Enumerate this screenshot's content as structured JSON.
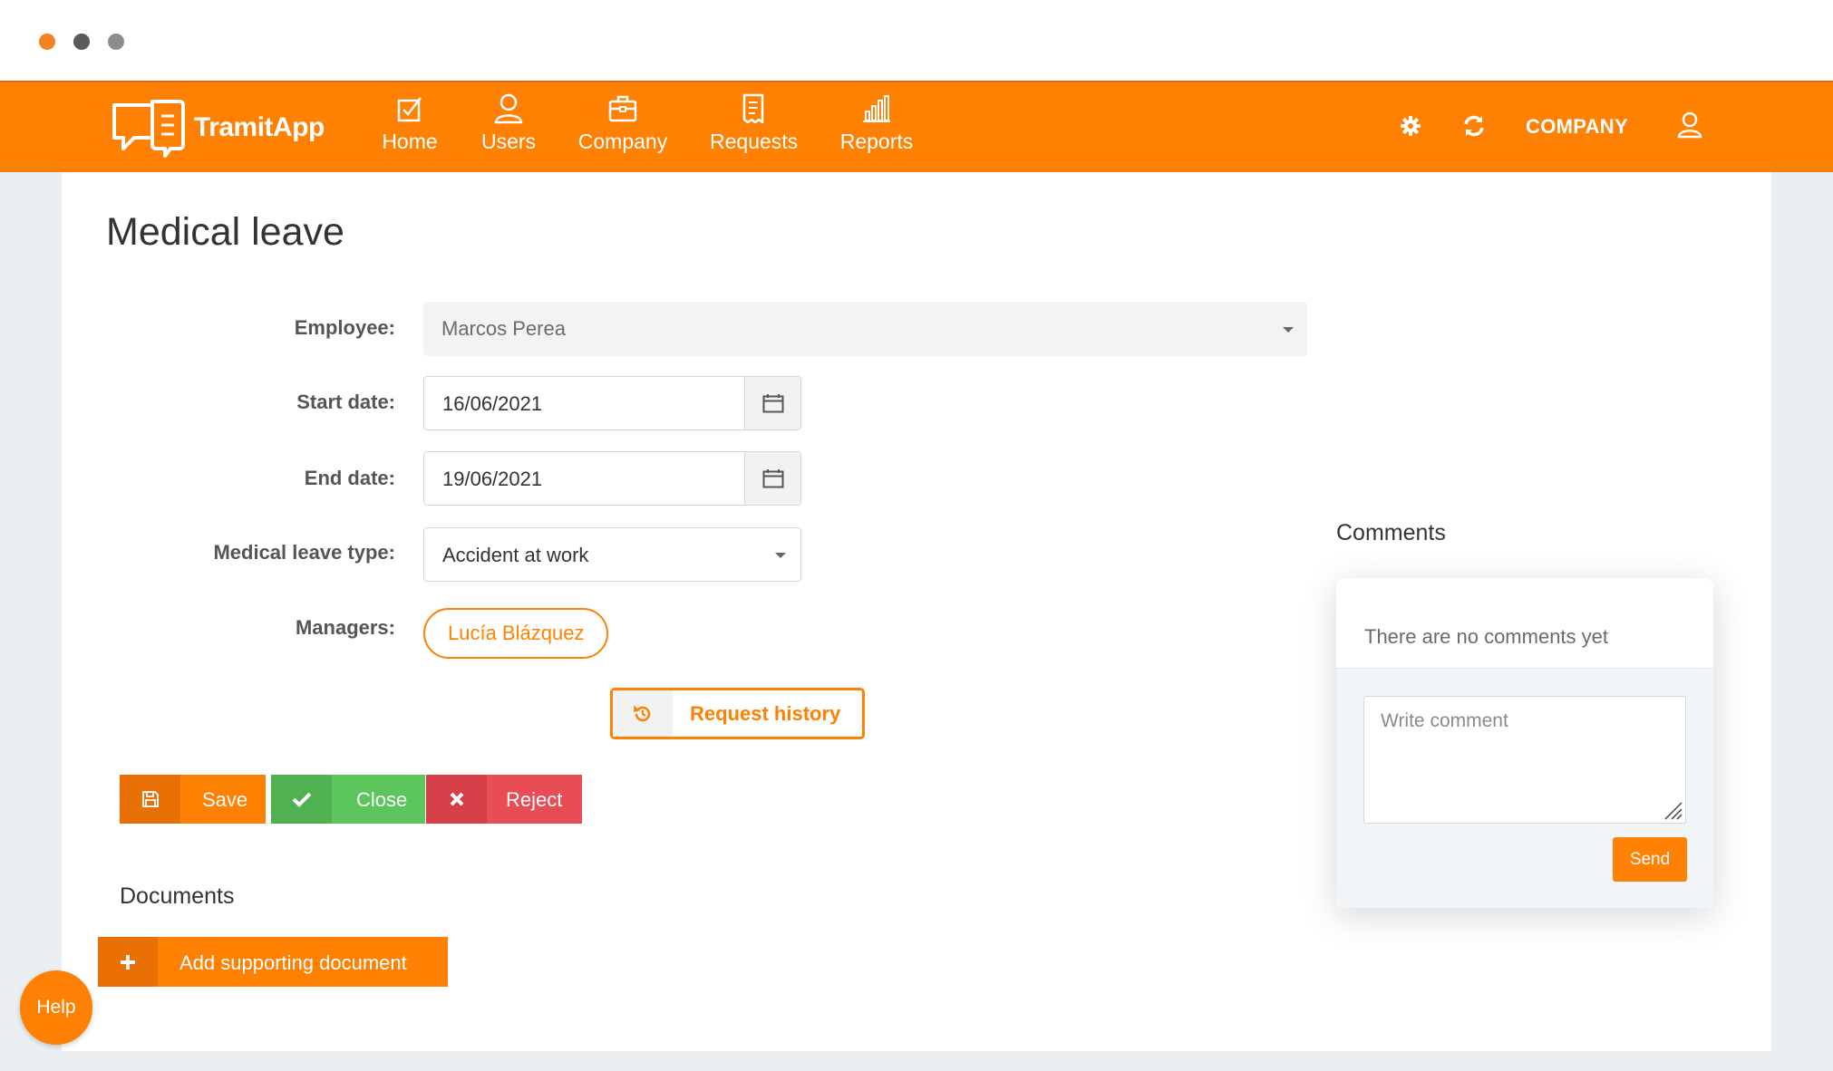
{
  "window": {
    "controls": [
      "close",
      "minimize",
      "maximize"
    ]
  },
  "navbar": {
    "logo_text": "TramitApp",
    "items": [
      {
        "label": "Home",
        "icon": "checkbox-icon"
      },
      {
        "label": "Users",
        "icon": "user-icon"
      },
      {
        "label": "Company",
        "icon": "briefcase-icon"
      },
      {
        "label": "Requests",
        "icon": "receipt-icon"
      },
      {
        "label": "Reports",
        "icon": "bar-chart-icon"
      }
    ],
    "settings_icon": "gear-icon",
    "refresh_icon": "refresh-icon",
    "company_label": "COMPANY",
    "profile_icon": "user-icon"
  },
  "page": {
    "title": "Medical leave"
  },
  "form": {
    "employee": {
      "label": "Employee:",
      "value": "Marcos Perea"
    },
    "start_date": {
      "label": "Start date:",
      "value": "16/06/2021"
    },
    "end_date": {
      "label": "End date:",
      "value": "19/06/2021"
    },
    "leave_type": {
      "label": "Medical leave type:",
      "value": "Accident at work"
    },
    "managers": {
      "label": "Managers:",
      "items": [
        "Lucía Blázquez"
      ]
    }
  },
  "buttons": {
    "request_history": "Request history",
    "save": "Save",
    "close": "Close",
    "reject": "Reject"
  },
  "documents": {
    "title": "Documents",
    "add_button": "Add supporting document"
  },
  "comments": {
    "title": "Comments",
    "empty_text": "There are no comments yet",
    "placeholder": "Write comment",
    "send": "Send"
  },
  "help": {
    "label": "Help"
  },
  "colors": {
    "brand_orange": "#fe8104",
    "success_green": "#5cc65d",
    "danger_red": "#e84c55"
  }
}
